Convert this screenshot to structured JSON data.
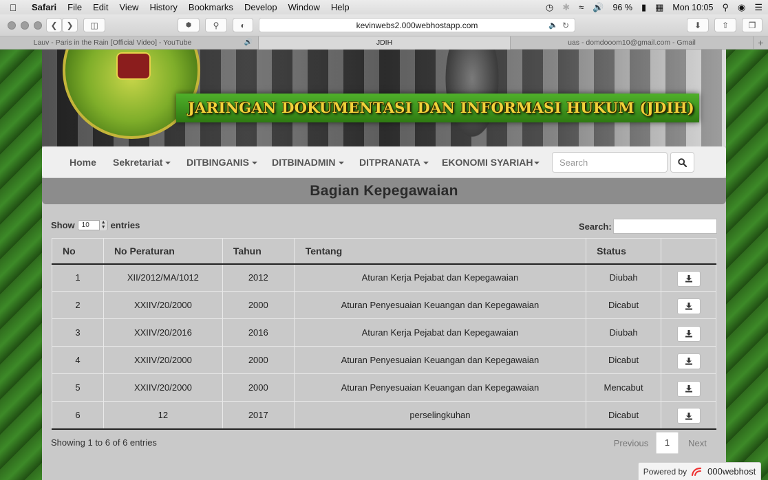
{
  "menubar": {
    "app_name": "Safari",
    "menus": [
      "File",
      "Edit",
      "View",
      "History",
      "Bookmarks",
      "Develop",
      "Window",
      "Help"
    ],
    "battery": "96 %",
    "clock": "Mon 10:05"
  },
  "browser": {
    "url": "kevinwebs2.000webhostapp.com",
    "tabs": [
      {
        "label": "Lauv - Paris in the Rain [Official Video] - YouTube",
        "active": false
      },
      {
        "label": "JDIH",
        "active": true
      },
      {
        "label": "uas - domdooom10@gmail.com - Gmail",
        "active": false
      }
    ]
  },
  "banner": {
    "title": "JARINGAN DOKUMENTASI DAN INFORMASI HUKUM (JDIH)"
  },
  "nav": {
    "items": [
      {
        "label": "Home",
        "dropdown": false
      },
      {
        "label": "Sekretariat",
        "dropdown": true
      },
      {
        "label": "DITBINGANIS",
        "dropdown": true
      },
      {
        "label": "DITBINADMIN",
        "dropdown": true
      },
      {
        "label": "DITPRANATA",
        "dropdown": true
      },
      {
        "label": "EKONOMI SYARIAH",
        "dropdown": true
      }
    ],
    "search_placeholder": "Search"
  },
  "section": {
    "title": "Bagian Kepegawaian"
  },
  "table_controls": {
    "show_label": "Show",
    "entries_value": "10",
    "entries_label": "entries",
    "search_label": "Search:"
  },
  "table": {
    "headers": [
      "No",
      "No Peraturan",
      "Tahun",
      "Tentang",
      "Status",
      ""
    ],
    "rows": [
      {
        "no": "1",
        "peraturan": "XII/2012/MA/1012",
        "tahun": "2012",
        "tentang": "Aturan Kerja Pejabat dan Kepegawaian",
        "status": "Diubah"
      },
      {
        "no": "2",
        "peraturan": "XXIIV/20/2000",
        "tahun": "2000",
        "tentang": "Aturan Penyesuaian Keuangan dan Kepegawaian",
        "status": "Dicabut"
      },
      {
        "no": "3",
        "peraturan": "XXIIV/20/2016",
        "tahun": "2016",
        "tentang": "Aturan Kerja Pejabat dan Kepegawaian",
        "status": "Diubah"
      },
      {
        "no": "4",
        "peraturan": "XXIIV/20/2000",
        "tahun": "2000",
        "tentang": "Aturan Penyesuaian Keuangan dan Kepegawaian",
        "status": "Dicabut"
      },
      {
        "no": "5",
        "peraturan": "XXIIV/20/2000",
        "tahun": "2000",
        "tentang": "Aturan Penyesuaian Keuangan dan Kepegawaian",
        "status": "Mencabut"
      },
      {
        "no": "6",
        "peraturan": "12",
        "tahun": "2017",
        "tentang": "perselingkuhan",
        "status": "Dicabut"
      }
    ]
  },
  "footer": {
    "info": "Showing 1 to 6 of 6 entries",
    "previous": "Previous",
    "page": "1",
    "next": "Next",
    "powered_by": "Powered by",
    "host_brand": "000webhost"
  }
}
